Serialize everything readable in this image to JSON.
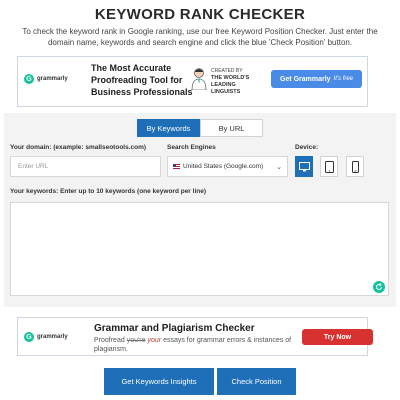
{
  "page": {
    "title": "KEYWORD RANK CHECKER",
    "intro": "To check the keyword rank in Google ranking, use our free Keyword Position Checker. Just enter the domain name, keywords and search engine and click the blue 'Check Position' button."
  },
  "ad_top": {
    "logo_text": "grammarly",
    "headline": "The Most Accurate Proofreading Tool for Business Professionals",
    "created_small": "CREATED BY",
    "created_big": "THE WORLD'S LEADING LINGUISTS",
    "cta_label": "Get Grammarly",
    "cta_suffix": "It's free"
  },
  "form": {
    "tabs": [
      {
        "label": "By Keywords",
        "active": true
      },
      {
        "label": "By URL",
        "active": false
      }
    ],
    "domain_label": "Your domain: (example: smallseotools.com)",
    "domain_placeholder": "Enter URL",
    "engine_label": "Search Engines",
    "engine_selected": "United States (Google.com)",
    "device_label": "Device:",
    "devices": [
      {
        "icon": "desktop-icon",
        "active": true
      },
      {
        "icon": "tablet-icon",
        "active": false
      },
      {
        "icon": "mobile-icon",
        "active": false
      }
    ],
    "keywords_label": "Your keywords: Enter up to 10 keywords (one keyword per line)"
  },
  "ad_bottom": {
    "logo_text": "grammarly",
    "headline": "Grammar and Plagiarism Checker",
    "sub_start": "Proofread ",
    "sub_strike": "you're",
    "sub_correct": "your",
    "sub_end": " essays for grammar errors & instances of plagiarism.",
    "cta_label": "Try Now"
  },
  "actions": {
    "insights_label": "Get Keywords Insights",
    "check_label": "Check Position"
  },
  "colors": {
    "primary": "#1f6fb8",
    "grammarly_green": "#15c39a",
    "cta_blue": "#4a8be8",
    "cta_red": "#d7322f"
  }
}
